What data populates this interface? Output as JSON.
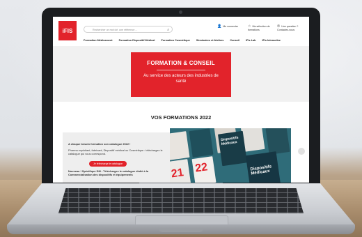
{
  "site": {
    "logo_text": "iFIS",
    "search_placeholder": "Rechercher un mot clé, une référence ...",
    "header_links": [
      {
        "label": "Me connecter",
        "icon": "user-icon"
      },
      {
        "label": "Ma sélection de formations",
        "icon": "star-icon"
      },
      {
        "label": "Une question ? Contactez-nous",
        "icon": "phone-icon"
      }
    ],
    "nav": [
      "Formation Médicament",
      "Formation Dispositif Médical",
      "Formation Cosmétique",
      "Séminaires et Ateliers",
      "Conseil",
      "IFis Lab",
      "IFis Interactive"
    ]
  },
  "hero": {
    "title": "FORMATION & CONSEIL",
    "subtitle": "Au service des acteurs des industries de santé"
  },
  "section": {
    "title": "VOS FORMATIONS 2022"
  },
  "promo": {
    "heading": "A chaque besoin formation son catalogue 2022 !",
    "text": "Pharma exploitant, fabricant, Dispositif médical ou Cosmétique : téléchargez le catalogue qui vous correspond.",
    "button": "Je télécharge le catalogue",
    "footer": "Nouveau ! Spécifique DM : Téléchargez le catalogue dédié à la Commercialisation des dispositifs et équipements"
  },
  "covers": {
    "year_a": "21",
    "year_b": "22",
    "title_a": "Dispositifs Médicaux",
    "title_b": "Dispositifs Médicaux"
  },
  "colors": {
    "brand_red": "#e2232b",
    "cover_teal": "#2f6c79"
  }
}
